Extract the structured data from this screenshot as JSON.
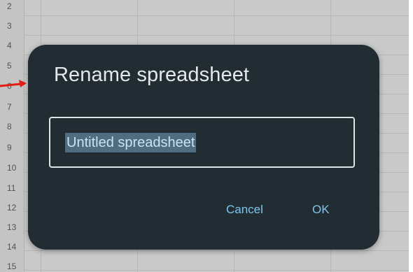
{
  "sheet": {
    "row_numbers": [
      "2",
      "3",
      "4",
      "5",
      "6",
      "7",
      "8",
      "9",
      "10",
      "11",
      "12",
      "13",
      "14",
      "15"
    ]
  },
  "dialog": {
    "title": "Rename spreadsheet",
    "name_value": "Untitled spreadsheet",
    "cancel_label": "Cancel",
    "ok_label": "OK"
  },
  "colors": {
    "dialog_bg": "#222d33",
    "button_text": "#7fc6ec",
    "selection_bg": "#4f6c80",
    "arrow": "#e31b13"
  },
  "icons": [
    "red-arrow-icon"
  ]
}
